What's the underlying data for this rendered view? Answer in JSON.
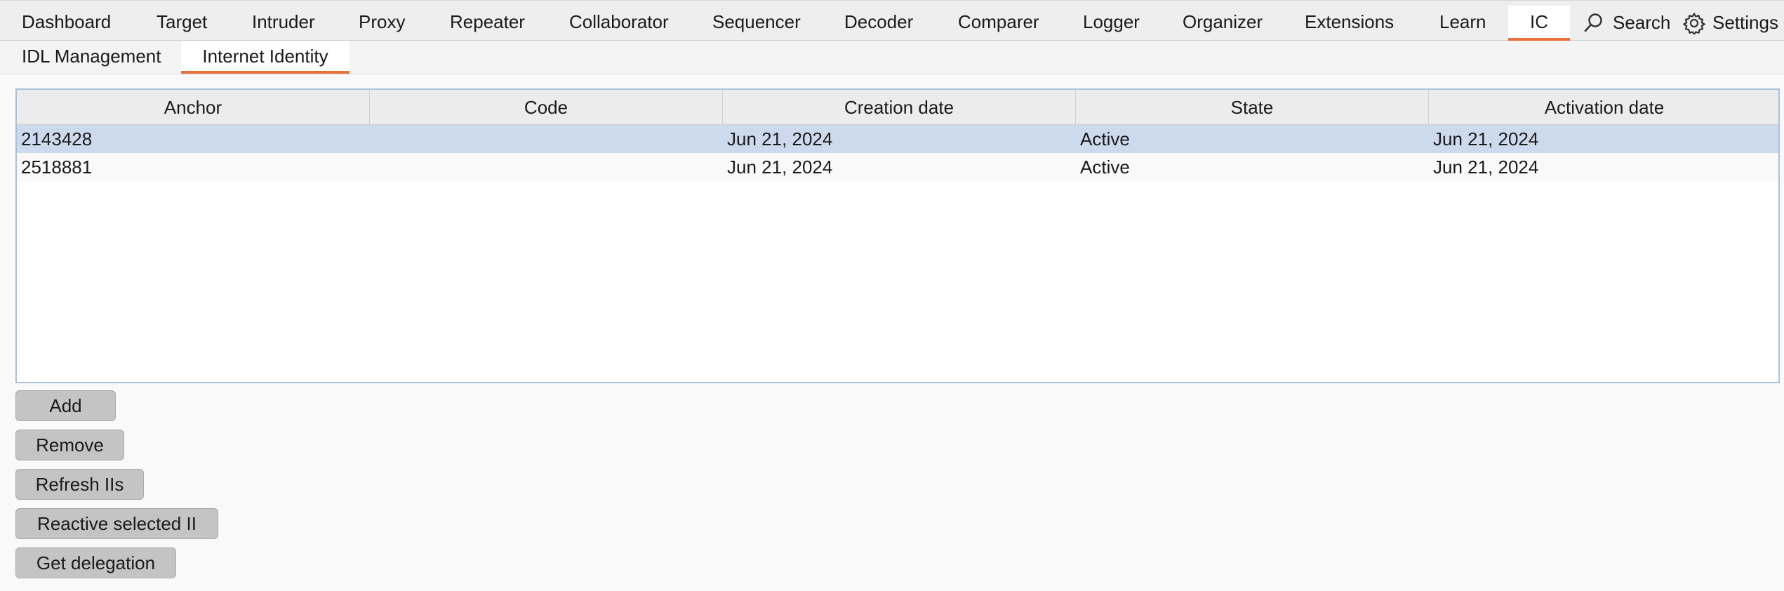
{
  "top_tabs": [
    "Dashboard",
    "Target",
    "Intruder",
    "Proxy",
    "Repeater",
    "Collaborator",
    "Sequencer",
    "Decoder",
    "Comparer",
    "Logger",
    "Organizer",
    "Extensions",
    "Learn",
    "IC"
  ],
  "tools": {
    "search_label": "Search",
    "settings_label": "Settings",
    "search_icon": "search-icon",
    "settings_icon": "gear-icon"
  },
  "sub_tabs": [
    "IDL Management",
    "Internet Identity"
  ],
  "active_top_tab": "IC",
  "active_sub_tab": "Internet Identity",
  "table": {
    "columns": [
      "Anchor",
      "Code",
      "Creation date",
      "State",
      "Activation date"
    ],
    "rows": [
      {
        "anchor": "2143428",
        "code": "",
        "creation_date": "Jun 21, 2024",
        "state": "Active",
        "activation_date": "Jun 21, 2024",
        "selected": true
      },
      {
        "anchor": "2518881",
        "code": "",
        "creation_date": "Jun 21, 2024",
        "state": "Active",
        "activation_date": "Jun 21, 2024",
        "selected": false
      }
    ]
  },
  "buttons": {
    "add": "Add",
    "remove": "Remove",
    "refresh": "Refresh IIs",
    "reactivate": "Reactive selected II",
    "delegation": "Get delegation"
  },
  "colors": {
    "accent": "#e8703a",
    "selection": "#cddaed",
    "table_border": "#a7c3dc"
  }
}
